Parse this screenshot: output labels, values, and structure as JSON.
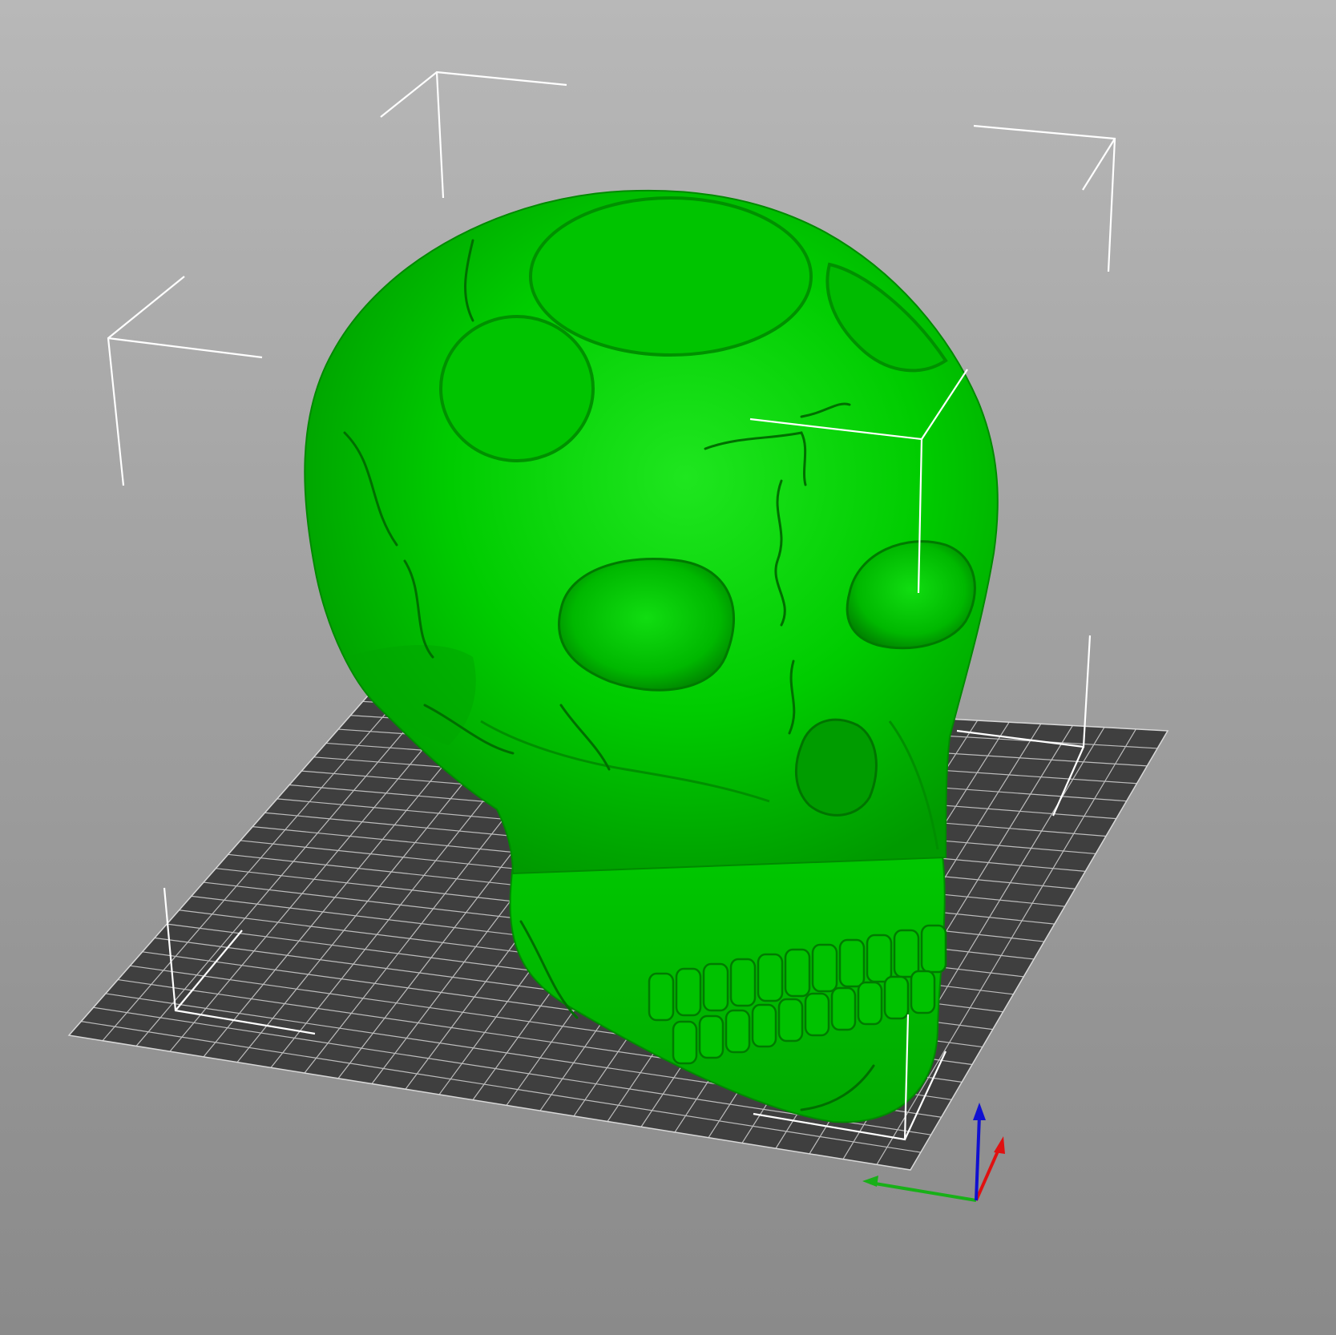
{
  "app": {
    "view": "3d-plater-viewport"
  },
  "scene": {
    "background_top": "#b8b8b8",
    "background_bottom": "#8a8a8a",
    "bed_color": "#3f3f3f",
    "bed_grid_color": "#bdbdbd",
    "model_color": "#00cc00",
    "model_shadow": "#008f00",
    "model_highlight": "#22ee22",
    "bbox_corner_color": "#ffffff"
  },
  "objects": [
    {
      "name": "skull",
      "selected": true
    }
  ],
  "axes": {
    "x_color": "#e01010",
    "y_color": "#18b018",
    "z_color": "#1010d0"
  },
  "icons": {
    "axis_gizmo": "xyz-axes-icon"
  }
}
